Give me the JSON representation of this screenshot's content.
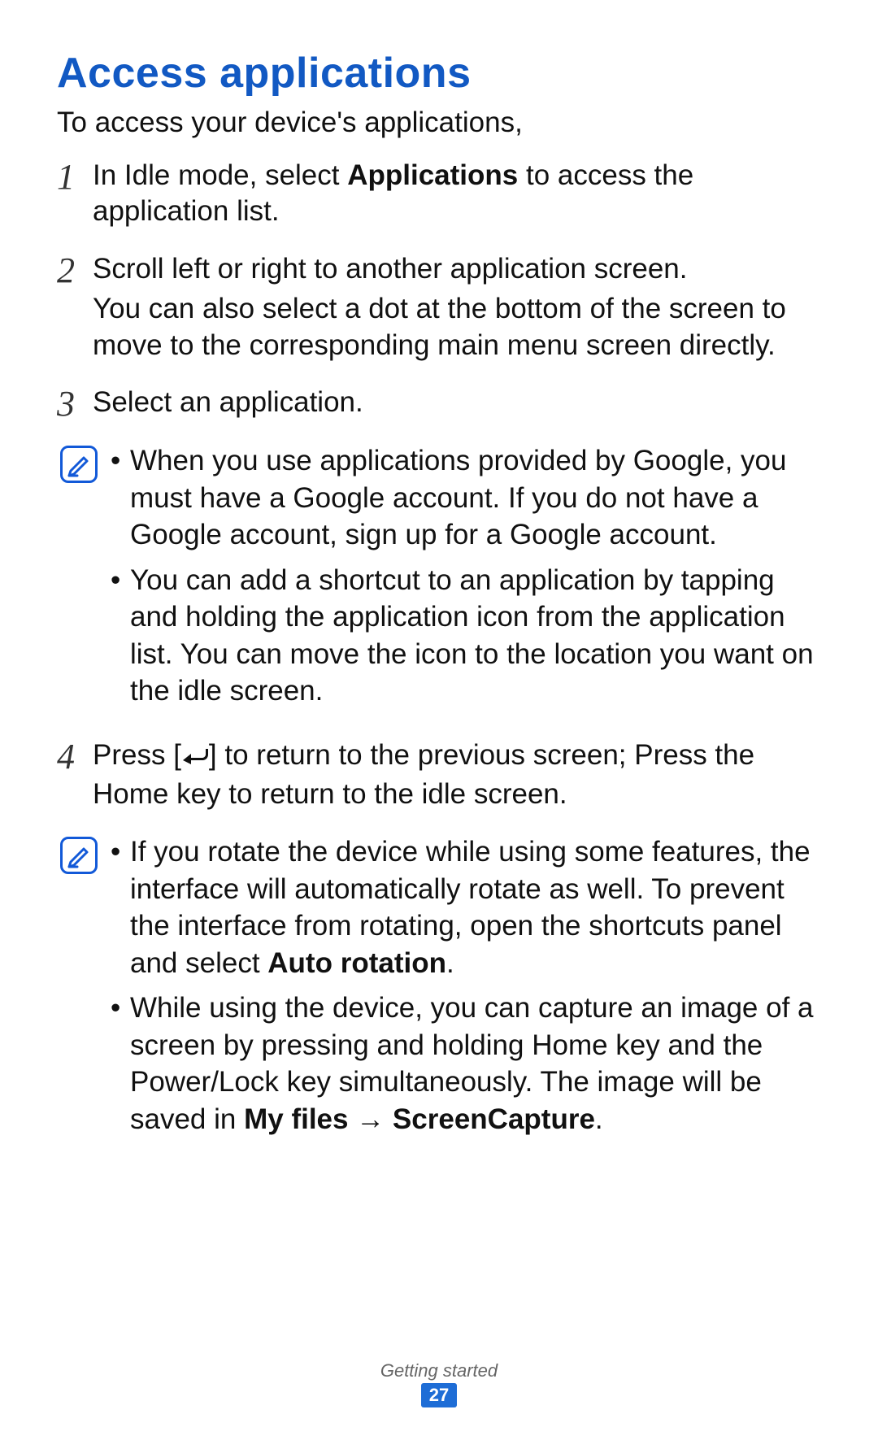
{
  "heading": "Access applications",
  "intro": "To access your device's applications,",
  "steps": {
    "s1": {
      "num": "1",
      "pre": "In Idle mode, select ",
      "bold": "Applications",
      "post": " to access the application list."
    },
    "s2": {
      "num": "2",
      "line1": "Scroll left or right to another application screen.",
      "line2": "You can also select a dot at the bottom of the screen to move to the corresponding main menu screen directly."
    },
    "s3": {
      "num": "3",
      "text": "Select an application."
    },
    "s4": {
      "num": "4",
      "pre": "Press [",
      "post": "] to return to the previous screen; Press the Home key to return to the idle screen."
    }
  },
  "notes": {
    "n1": {
      "b1": "When you use applications provided by Google, you must have a Google account. If you do not have a Google account, sign up for a Google account.",
      "b2": "You can add a shortcut to an application by tapping and holding the application icon from the application list. You can move the icon to the location you want on the idle screen."
    },
    "n2": {
      "b1_pre": "If you rotate the device while using some features, the interface will automatically rotate as well. To prevent the interface from rotating, open the shortcuts panel and select ",
      "b1_bold": "Auto rotation",
      "b1_post": ".",
      "b2_pre": "While using the device, you can capture an image of a screen by pressing and holding Home key and the Power/Lock key simultaneously. The image will be saved in ",
      "b2_bold": "My files → ScreenCapture",
      "b2_post": "."
    }
  },
  "footer": {
    "section": "Getting started",
    "page": "27"
  }
}
